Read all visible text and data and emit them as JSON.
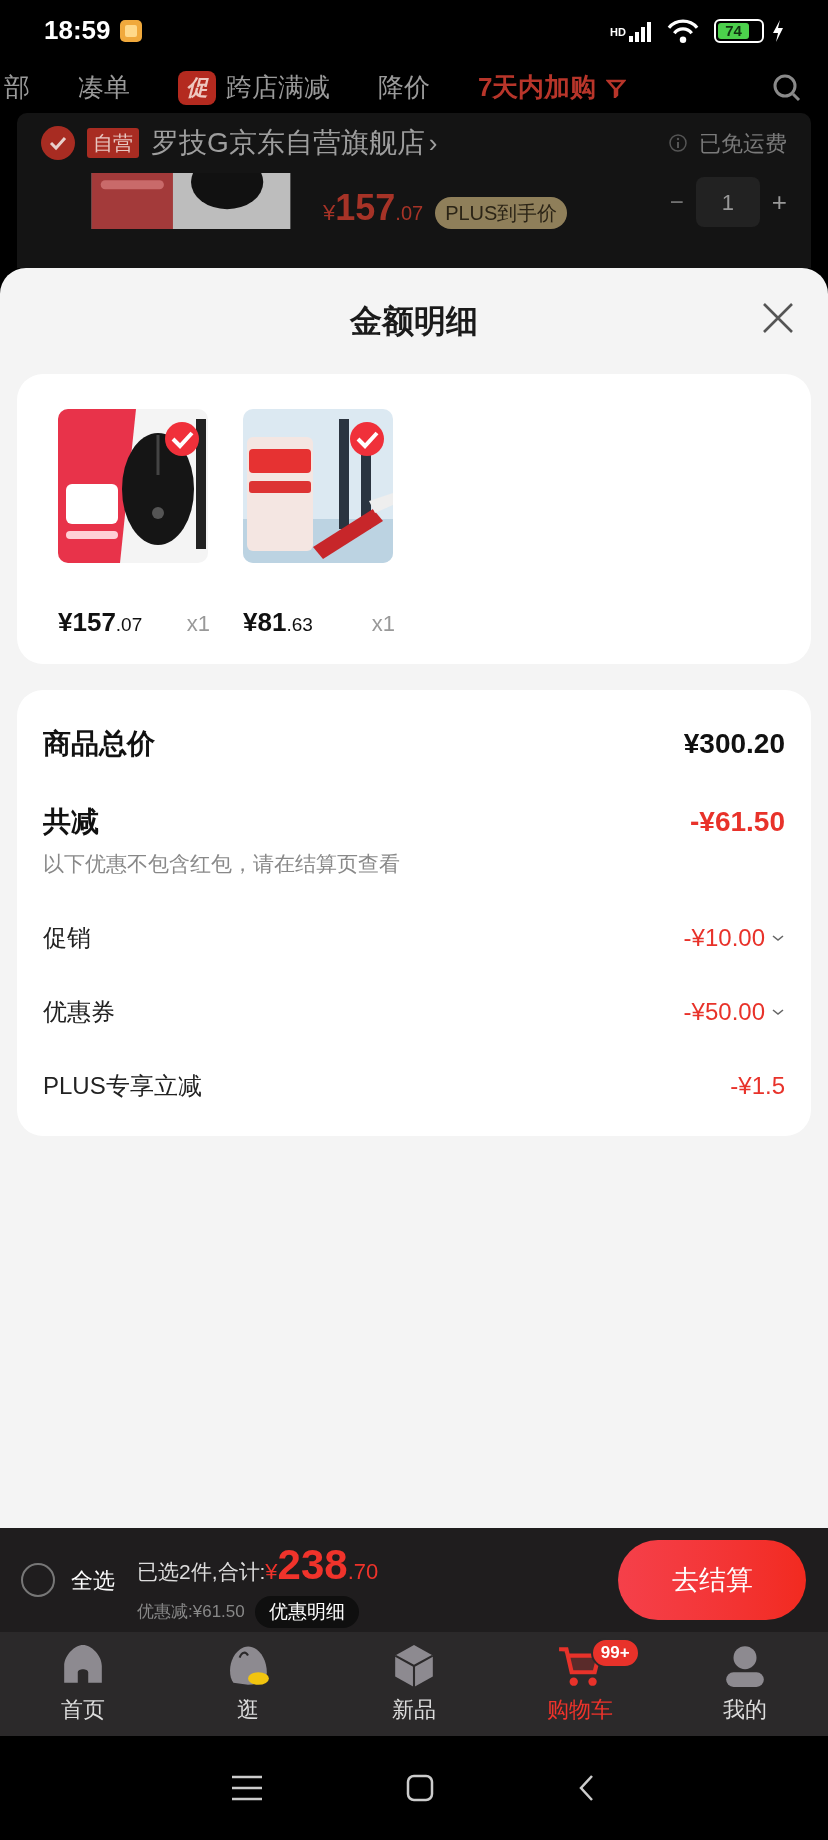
{
  "status_bar": {
    "time": "18:59",
    "network": "HD",
    "battery": "74"
  },
  "filter_tabs": [
    {
      "label": "部",
      "selected": false
    },
    {
      "label": "凑单",
      "selected": false
    },
    {
      "label": "跨店满减",
      "selected": false,
      "badge": "促"
    },
    {
      "label": "降价",
      "selected": false
    },
    {
      "label": "7天内加购",
      "selected": true
    }
  ],
  "store": {
    "checked": true,
    "badge": "自营",
    "name": "罗技G京东自营旗舰店",
    "chevron": "›",
    "shipping": "已免运费"
  },
  "cart_item": {
    "currency": "¥",
    "price_int": "157",
    "price_dec": ".07",
    "tag": "PLUS到手价",
    "minus": "−",
    "quantity": "1",
    "plus": "+"
  },
  "sheet": {
    "title": "金额明细",
    "products": [
      {
        "kind": "mouse",
        "selected": true,
        "price_int": "¥157",
        "price_dec": ".07",
        "quantity": "x1"
      },
      {
        "kind": "wifi-card",
        "selected": true,
        "price_int": "¥81",
        "price_dec": ".63",
        "quantity": "x1"
      }
    ],
    "total": {
      "label": "商品总价",
      "value": "¥300.20"
    },
    "discount": {
      "label": "共减",
      "value": "-¥61.50",
      "note": "以下优惠不包含红包，请在结算页查看"
    },
    "details": [
      {
        "label": "促销",
        "value": "-¥10.00",
        "expandable": true
      },
      {
        "label": "优惠券",
        "value": "-¥50.00",
        "expandable": true
      },
      {
        "label": "PLUS专享立减",
        "value": "-¥1.5",
        "expandable": false
      }
    ]
  },
  "checkout_bar": {
    "select_all": {
      "label": "全选",
      "checked": false
    },
    "summary": "已选2件,合计:",
    "currency": "¥",
    "total_int": "238",
    "total_dec": ".70",
    "saved": "优惠减:¥61.50",
    "detail_button": "优惠明细",
    "checkout_button": "去结算"
  },
  "bottom_nav": [
    {
      "kind": "home",
      "label": "首页",
      "selected": false
    },
    {
      "kind": "browse",
      "label": "逛",
      "selected": false
    },
    {
      "kind": "new",
      "label": "新品",
      "selected": false
    },
    {
      "kind": "cart",
      "label": "购物车",
      "selected": true,
      "badge": "99+"
    },
    {
      "kind": "profile",
      "label": "我的",
      "selected": false
    }
  ]
}
